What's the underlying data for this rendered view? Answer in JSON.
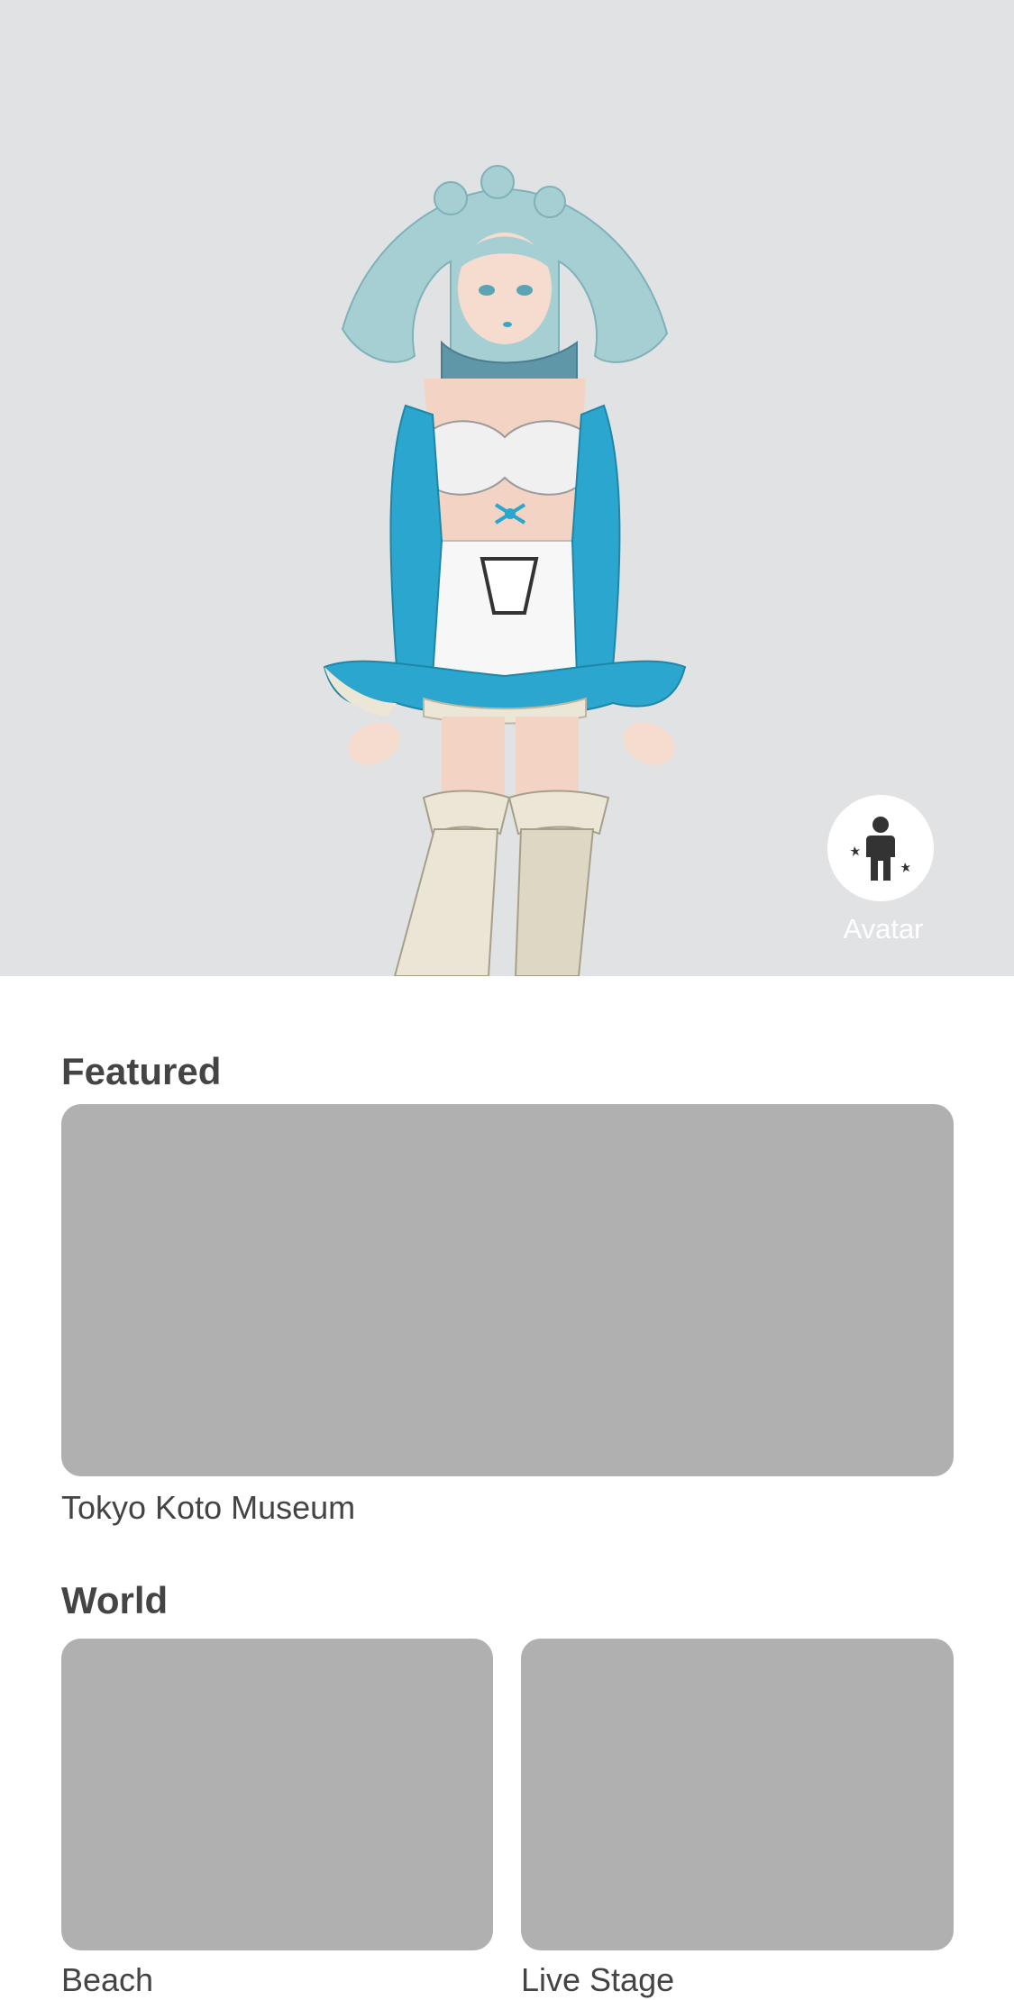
{
  "hero": {
    "background": "#e1e2e4",
    "character_icon": "anime-character-illustration",
    "avatar_button": {
      "icon": "person-sparkle-icon",
      "label": "Avatar"
    }
  },
  "featured": {
    "title": "Featured",
    "items": [
      {
        "label": "Tokyo Koto Museum"
      }
    ]
  },
  "world": {
    "title": "World",
    "items": [
      {
        "label": "Beach"
      },
      {
        "label": "Live Stage"
      }
    ]
  },
  "colors": {
    "placeholder": "#b0b0b0",
    "text": "#444444",
    "hair": "#9fc9cf",
    "accent": "#2aa7cc"
  }
}
